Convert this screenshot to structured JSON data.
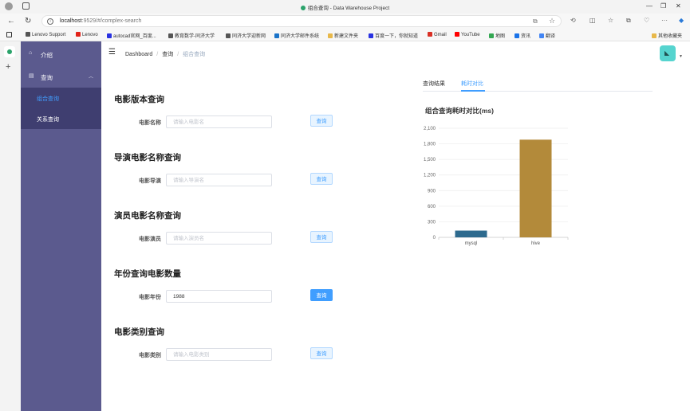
{
  "browser": {
    "window_title": "组合查询 - Data Warehouse Project",
    "url_host": "localhost",
    "url_path": ":9529/#/complex-search",
    "bookmarks": [
      {
        "label": "Lenovo Support",
        "icon": "page-icon",
        "color": "#555555"
      },
      {
        "label": "Lenovo",
        "icon": "lenovo-icon",
        "color": "#e2231a"
      },
      {
        "label": "autocad官网_百度...",
        "icon": "baidu-icon",
        "color": "#2932e1"
      },
      {
        "label": "教育数学-同济大学",
        "icon": "page-icon",
        "color": "#555555"
      },
      {
        "label": "同济大学迎新网",
        "icon": "link-icon",
        "color": "#555555"
      },
      {
        "label": "同济大学邮件系统",
        "icon": "mail-icon",
        "color": "#1a73c8"
      },
      {
        "label": "新建文件夹",
        "icon": "folder-icon",
        "color": "#e8b84a"
      },
      {
        "label": "百度一下，你就知道",
        "icon": "baidu-icon",
        "color": "#2932e1"
      },
      {
        "label": "Gmail",
        "icon": "gmail-icon",
        "color": "#d93025"
      },
      {
        "label": "YouTube",
        "icon": "youtube-icon",
        "color": "#ff0000"
      },
      {
        "label": "地图",
        "icon": "map-icon",
        "color": "#34a853"
      },
      {
        "label": "资讯",
        "icon": "news-icon",
        "color": "#1a73e8"
      },
      {
        "label": "翻译",
        "icon": "translate-icon",
        "color": "#4285f4"
      }
    ],
    "other_bookmarks": "其他收藏夹"
  },
  "sidebar": {
    "items": [
      {
        "label": "介绍",
        "icon": "home-icon"
      },
      {
        "label": "查询",
        "icon": "document-icon",
        "expanded": true
      }
    ],
    "subitems": [
      {
        "label": "组合查询",
        "active": true
      },
      {
        "label": "关系查询",
        "active": false
      }
    ],
    "colors": {
      "bg": "#5b5a8e",
      "submenu_bg": "#3f3e70",
      "active_text": "#409eff"
    }
  },
  "header": {
    "breadcrumb": [
      "Dashboard",
      "查询",
      "组合查询"
    ]
  },
  "forms": [
    {
      "title": "电影版本查询",
      "label": "电影名称",
      "placeholder": "请输入电影名",
      "value": "",
      "button": "查询"
    },
    {
      "title": "导演电影名称查询",
      "label": "电影导演",
      "placeholder": "请输入导演名",
      "value": "",
      "button": "查询"
    },
    {
      "title": "演员电影名称查询",
      "label": "电影演员",
      "placeholder": "请输入演员名",
      "value": "",
      "button": "查询"
    },
    {
      "title": "年份查询电影数量",
      "label": "电影年份",
      "placeholder": "",
      "value": "1988",
      "button": "查询"
    },
    {
      "title": "电影类别查询",
      "label": "电影类别",
      "placeholder": "请输入电影类别",
      "value": "",
      "button": "查询"
    }
  ],
  "tabs": [
    {
      "label": "查询结果",
      "active": false
    },
    {
      "label": "耗时对比",
      "active": true
    }
  ],
  "chart_title": "组合查询耗时对比(ms)",
  "chart_data": {
    "type": "bar",
    "title": "组合查询耗时对比(ms)",
    "categories": [
      "mysql",
      "hive"
    ],
    "values": [
      130,
      1880
    ],
    "bar_colors": [
      "#2d6a8e",
      "#b38a3a"
    ],
    "yticks": [
      0,
      300,
      600,
      900,
      1200,
      1500,
      1800,
      2100
    ],
    "ytick_labels": [
      "0",
      "300",
      "600",
      "900",
      "1,200",
      "1,500",
      "1,800",
      "2,100"
    ],
    "ylim": [
      0,
      2100
    ],
    "grid": true
  }
}
